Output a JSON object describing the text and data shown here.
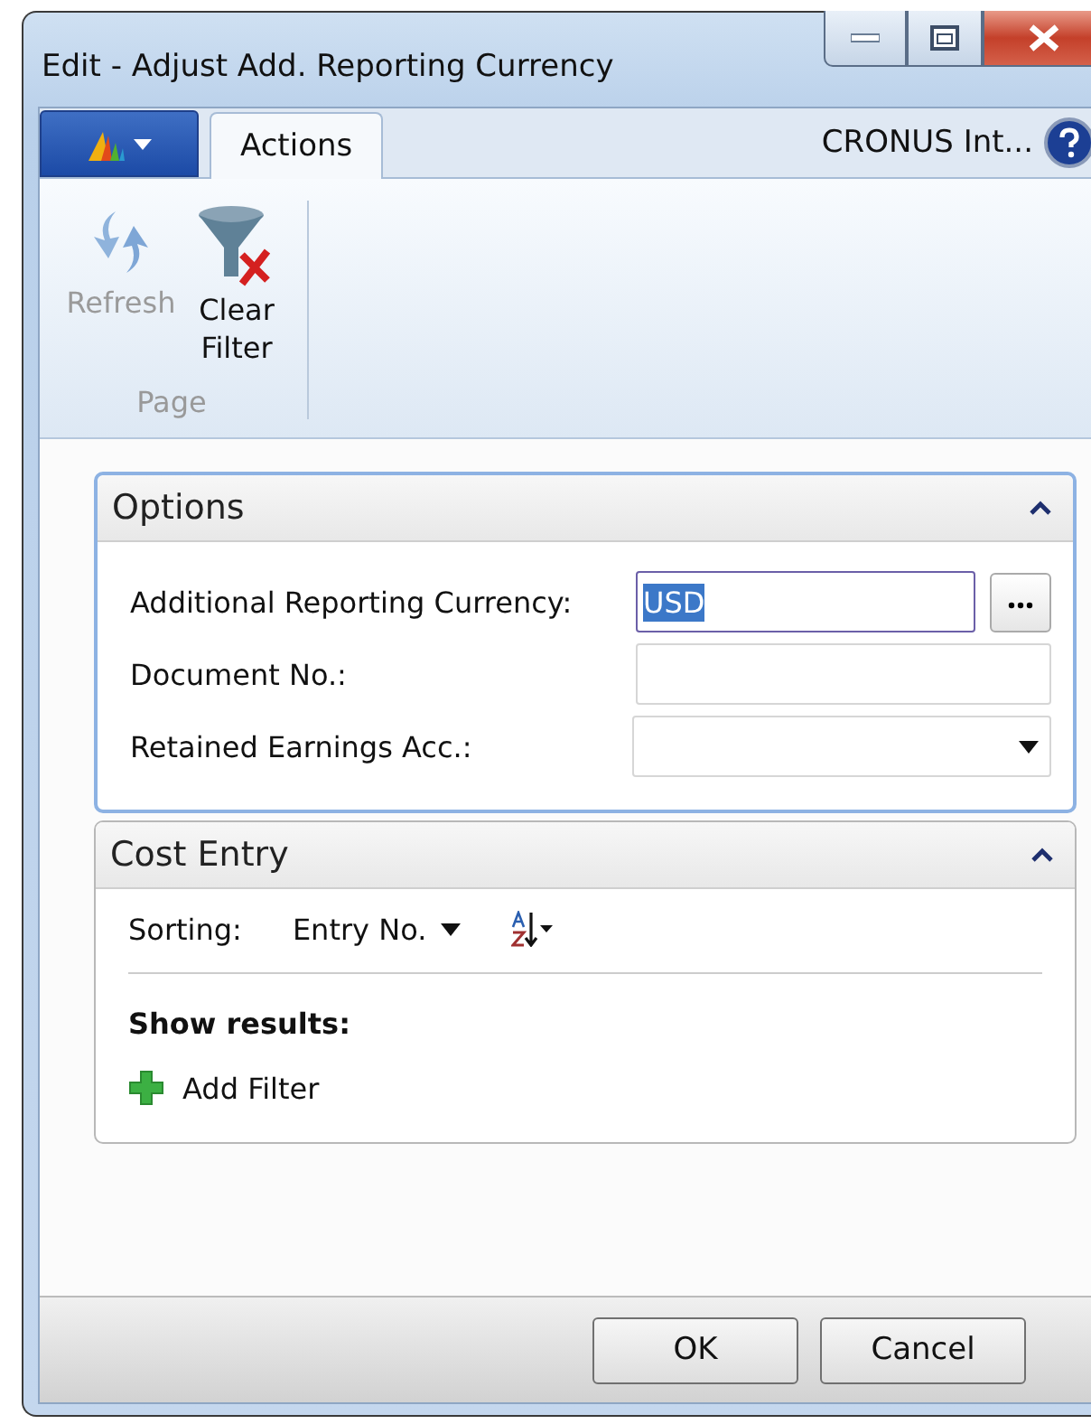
{
  "window": {
    "title": "Edit - Adjust Add. Reporting Currency"
  },
  "ribbon": {
    "tabs": [
      {
        "label": "Actions",
        "selected": true
      }
    ],
    "company": "CRONUS Int...",
    "groups": [
      {
        "label": "Page",
        "actions": [
          {
            "label": "Refresh",
            "kind": "refresh",
            "disabled": true
          },
          {
            "label": "Clear Filter",
            "kind": "clear-filter",
            "disabled": false
          }
        ]
      }
    ]
  },
  "fasttabs": [
    {
      "title": "Options",
      "expanded": true,
      "focused": true,
      "kind": "options",
      "fields": [
        {
          "label": "Additional Reporting Currency:",
          "kind": "lookup",
          "value": "USD",
          "focused": true
        },
        {
          "label": "Document No.:",
          "kind": "text",
          "focused": false
        },
        {
          "label": "Retained Earnings Acc.:",
          "kind": "dropdown",
          "focused": false
        }
      ]
    },
    {
      "title": "Cost Entry",
      "expanded": true,
      "focused": false,
      "kind": "filter",
      "sorting": {
        "label": "Sorting:",
        "value": "Entry No."
      },
      "results_label": "Show results:",
      "add_filter": "Add Filter"
    }
  ],
  "buttons": [
    {
      "label": "OK"
    },
    {
      "label": "Cancel"
    }
  ]
}
